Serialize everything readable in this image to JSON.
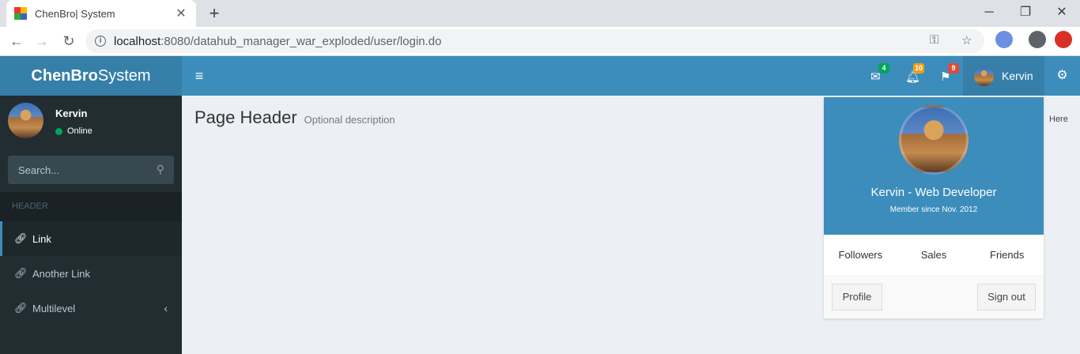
{
  "browser": {
    "tab_title": "ChenBro| System",
    "tab_close": "✕",
    "new_tab": "+",
    "url_host": "localhost",
    "url_rest": ":8080/datahub_manager_war_exploded/user/login.do"
  },
  "header": {
    "logo_bold": "ChenBro",
    "logo_rest": "System",
    "messages_count": "4",
    "notifications_count": "10",
    "tasks_count": "9",
    "user_name": "Kervin",
    "colors": {
      "primary": "#3c8dbc",
      "dark": "#367fa9",
      "green": "#00a65a",
      "yellow": "#f39c12",
      "red": "#dd4b39"
    }
  },
  "sidebar": {
    "user_name": "Kervin",
    "status": "Online",
    "search_placeholder": "Search...",
    "section_header": "HEADER",
    "items": [
      {
        "label": "Link",
        "icon": "link-icon",
        "active": true
      },
      {
        "label": "Another Link",
        "icon": "link-icon",
        "active": false
      },
      {
        "label": "Multilevel",
        "icon": "link-icon",
        "active": false
      }
    ]
  },
  "content": {
    "title": "Page Header",
    "description": "Optional description",
    "breadcrumb": "Here"
  },
  "user_dropdown": {
    "name": "Kervin - Web Developer",
    "member_since": "Member since Nov. 2012",
    "links": [
      "Followers",
      "Sales",
      "Friends"
    ],
    "profile_button": "Profile",
    "signout_button": "Sign out"
  }
}
